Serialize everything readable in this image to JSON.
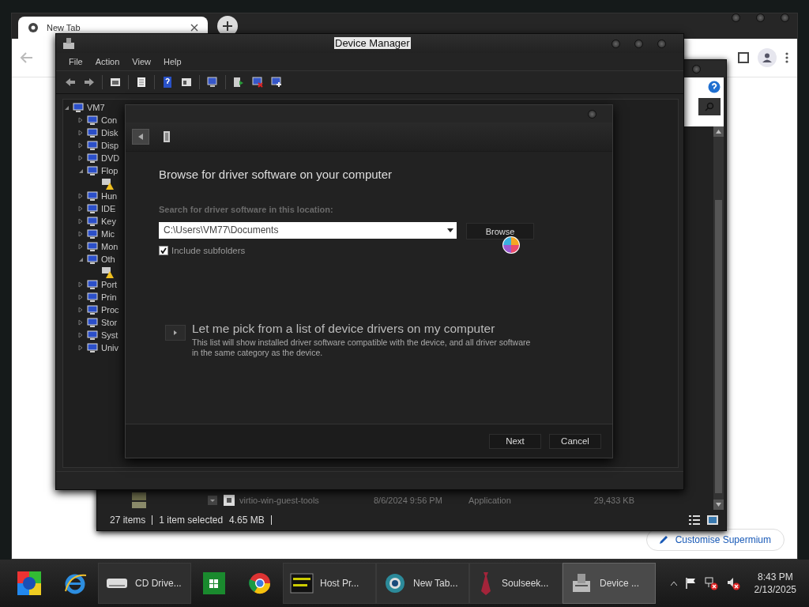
{
  "browser": {
    "tab": {
      "title": "New Tab",
      "selected": true
    },
    "customise_button": "Customise Supermium"
  },
  "explorer": {
    "file": {
      "name": "virtio-win-guest-tools",
      "date": "8/6/2024 9:56 PM",
      "type": "Application",
      "size": "29,433 KB"
    },
    "status": {
      "items": "27 items",
      "selection": "1 item selected",
      "size": "4.65 MB"
    }
  },
  "device_manager": {
    "title": "Device Manager",
    "menu": [
      "File",
      "Action",
      "View",
      "Help"
    ],
    "tree": {
      "label": "VM7",
      "expanded": true,
      "children": [
        {
          "label": "Con",
          "expanded": false
        },
        {
          "label": "Disk",
          "expanded": false
        },
        {
          "label": "Disp",
          "expanded": false
        },
        {
          "label": "DVD",
          "expanded": false
        },
        {
          "label": "Flop",
          "expanded": true,
          "children": [
            {
              "warning": true
            }
          ]
        },
        {
          "label": "Hun",
          "expanded": false
        },
        {
          "label": "IDE",
          "expanded": false
        },
        {
          "label": "Key",
          "expanded": false
        },
        {
          "label": "Mic",
          "expanded": false
        },
        {
          "label": "Mon",
          "expanded": false
        },
        {
          "label": "Oth",
          "expanded": true,
          "children": [
            {
              "warning": true
            }
          ]
        },
        {
          "label": "Port",
          "expanded": false
        },
        {
          "label": "Prin",
          "expanded": false
        },
        {
          "label": "Proc",
          "expanded": false
        },
        {
          "label": "Stor",
          "expanded": false
        },
        {
          "label": "Syst",
          "expanded": false
        },
        {
          "label": "Univ",
          "expanded": false
        }
      ]
    }
  },
  "dialog": {
    "heading": "Browse for driver software on your computer",
    "location_label": "Search for driver software in this location:",
    "path": "C:\\Users\\VM77\\Documents",
    "browse_button": "Browse",
    "include_subfolders": {
      "label": "Include subfolders",
      "checked": true
    },
    "pick_option": {
      "title": "Let me pick from a list of device drivers on my computer",
      "description": "This list will show installed driver software compatible with the device, and all driver software in the same category as the device."
    },
    "buttons": [
      "Next",
      "Cancel"
    ]
  },
  "taskbar": {
    "items": [
      {
        "kind": "orb",
        "selected": false
      },
      {
        "kind": "ie",
        "selected": false
      },
      {
        "kind": "drive",
        "label": "CD Drive...",
        "selected": false
      },
      {
        "kind": "store",
        "selected": false
      },
      {
        "kind": "chrome",
        "selected": false
      },
      {
        "kind": "console",
        "label": "Host Pr...",
        "selected": false
      },
      {
        "kind": "globe",
        "label": "New Tab...",
        "selected": false
      },
      {
        "kind": "tie",
        "label": "Soulseek...",
        "selected": false
      },
      {
        "kind": "devmgr",
        "label": "Device ...",
        "selected": true
      }
    ],
    "time": "8:43 PM",
    "date": "2/13/2025"
  }
}
